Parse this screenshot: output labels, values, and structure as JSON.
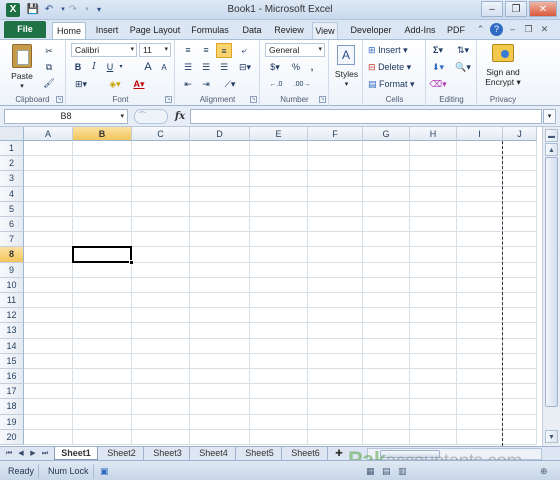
{
  "window": {
    "title": "Book1 - Microsoft Excel",
    "app_icon": "X",
    "qat": {
      "save": "save-icon",
      "undo": "undo-icon",
      "redo": "redo-icon",
      "customize": "customize-qat-icon"
    },
    "controls": {
      "minimize": "–",
      "restore": "❐",
      "close": "✕"
    }
  },
  "tabs": {
    "file": "File",
    "items": [
      "Home",
      "Insert",
      "Page Layout",
      "Formulas",
      "Data",
      "Review",
      "View",
      "Developer",
      "Add-Ins",
      "PDF"
    ],
    "active": "Home"
  },
  "ribbon": {
    "clipboard": {
      "label": "Clipboard",
      "paste": "Paste"
    },
    "font": {
      "label": "Font",
      "name": "Calibri",
      "size": "11",
      "bold": "B",
      "italic": "I",
      "underline": "U",
      "grow": "A",
      "shrink": "A"
    },
    "alignment": {
      "label": "Alignment"
    },
    "number": {
      "label": "Number",
      "format": "General",
      "currency": "$",
      "percent": "%",
      "comma": ","
    },
    "styles": {
      "label": "Styles",
      "styles_btn": "Styles"
    },
    "cells": {
      "label": "Cells",
      "insert": "Insert",
      "delete": "Delete",
      "format": "Format"
    },
    "editing": {
      "label": "Editing",
      "sum": "Σ"
    },
    "privacy": {
      "label": "Privacy",
      "sign": "Sign and",
      "encrypt": "Encrypt"
    }
  },
  "formula_bar": {
    "name_box": "B8",
    "fx": "fx",
    "value": ""
  },
  "grid": {
    "columns": [
      "A",
      "B",
      "C",
      "D",
      "E",
      "F",
      "G",
      "H",
      "I",
      "J"
    ],
    "rows": [
      "1",
      "2",
      "3",
      "4",
      "5",
      "6",
      "7",
      "8",
      "9",
      "10",
      "11",
      "12",
      "13",
      "14",
      "15",
      "16",
      "17",
      "18",
      "19",
      "20"
    ],
    "selected_column": "B",
    "selected_row": "8"
  },
  "sheets": {
    "items": [
      "Sheet1",
      "Sheet2",
      "Sheet3",
      "Sheet4",
      "Sheet5",
      "Sheet6"
    ],
    "active": "Sheet1"
  },
  "status": {
    "mode": "Ready",
    "num_lock": "Num Lock"
  },
  "watermark": {
    "brand": "Pak",
    "rest": "accountants.com"
  }
}
